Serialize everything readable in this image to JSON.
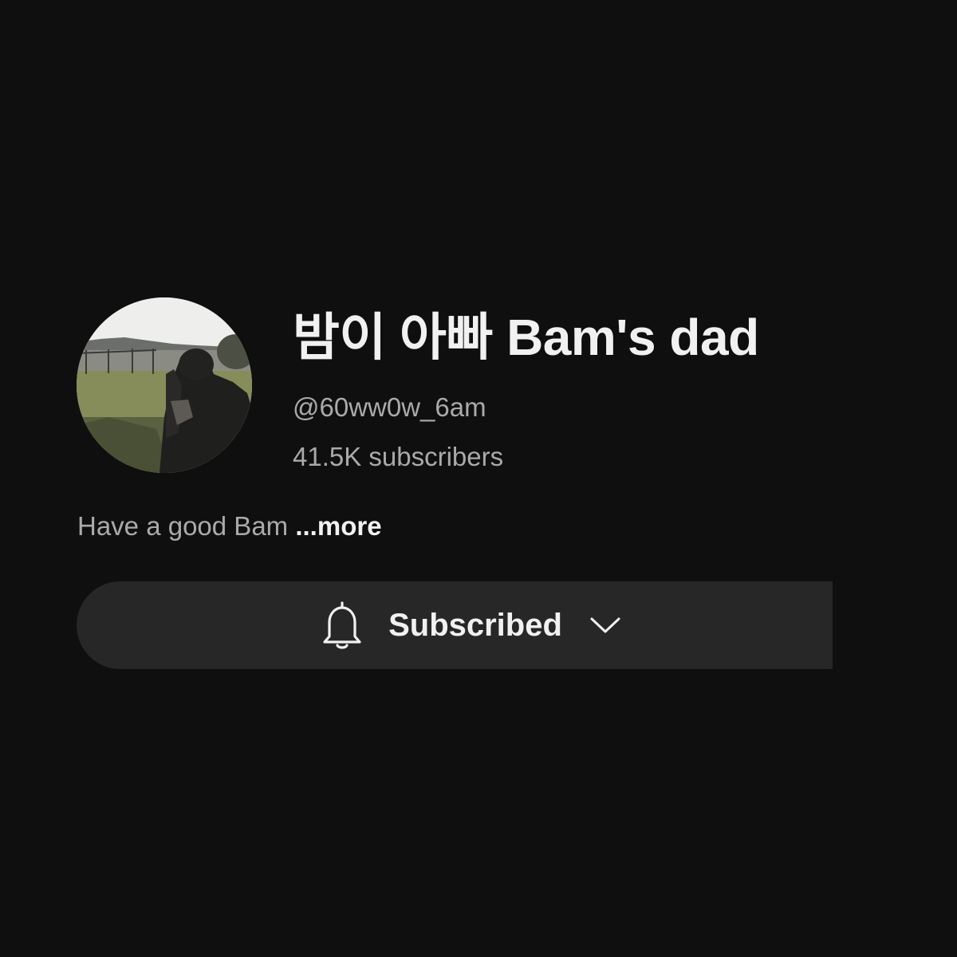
{
  "channel": {
    "name": "밤이 아빠 Bam's dad",
    "handle": "@60ww0w_6am",
    "subscribers": "41.5K subscribers",
    "description": "Have a good Bam",
    "more_label": "...more"
  },
  "subscribe": {
    "label": "Subscribed",
    "icon": "bell-icon",
    "dropdown_icon": "chevron-down-icon"
  },
  "colors": {
    "background": "#0f0f0f",
    "primary_text": "#f1f1f1",
    "secondary_text": "#aaaaaa",
    "button_background": "#272727"
  }
}
